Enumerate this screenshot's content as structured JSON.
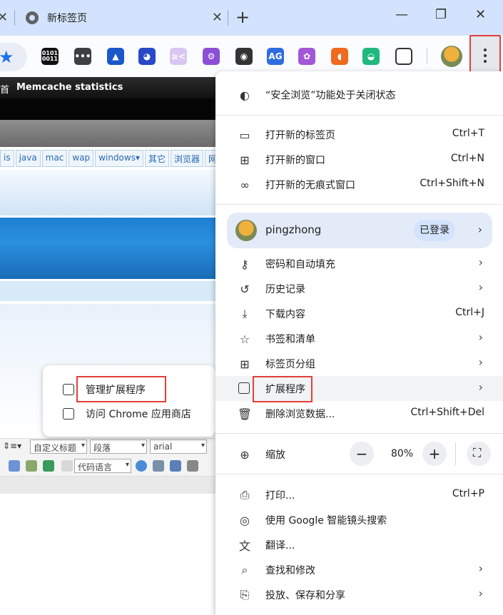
{
  "tab": {
    "title": "新标签页"
  },
  "toolbar": {
    "extensions": [
      {
        "name": "binary-extension",
        "text": "0101\n0011",
        "color": "#111111"
      },
      {
        "name": "dots-extension",
        "text": "•••",
        "color": "#3c4043"
      },
      {
        "name": "triangle-extension",
        "text": "▲",
        "color": "#1a58c9"
      },
      {
        "name": "robot-extension",
        "text": "◕",
        "color": "#2748c7"
      },
      {
        "name": "face-extension",
        "text": "≥<",
        "color": "#d9c6f2"
      },
      {
        "name": "gear-extension",
        "text": "⚙",
        "color": "#8b4fd6"
      },
      {
        "name": "camera-extension",
        "text": "◉",
        "color": "#333333"
      },
      {
        "name": "ag-extension",
        "text": "AG",
        "color": "#2f6ddf"
      },
      {
        "name": "brain-extension",
        "text": "✿",
        "color": "#a356d8"
      },
      {
        "name": "orange-extension",
        "text": "◖",
        "color": "#f06a1f"
      },
      {
        "name": "planet-extension",
        "text": "◒",
        "color": "#20b87f"
      }
    ]
  },
  "page": {
    "topbar_left": "首",
    "topbar_label": "Memcache statistics",
    "nav": [
      "is",
      "java",
      "mac",
      "wap",
      "windows▾",
      "其它",
      "浏览器",
      "网"
    ],
    "editor": {
      "heading_select": "自定义标题",
      "para_select": "段落",
      "font_select": "arial",
      "code_select": "代码语言"
    }
  },
  "submenu": {
    "items": [
      {
        "label": "管理扩展程序"
      },
      {
        "label": "访问 Chrome 应用商店"
      }
    ]
  },
  "menu": {
    "safe_browsing": "“安全浏览”功能处于关闭状态",
    "new_tab": {
      "label": "打开新的标签页",
      "shortcut": "Ctrl+T"
    },
    "new_window": {
      "label": "打开新的窗口",
      "shortcut": "Ctrl+N"
    },
    "incognito": {
      "label": "打开新的无痕式窗口",
      "shortcut": "Ctrl+Shift+N"
    },
    "profile": {
      "name": "pingzhong",
      "status": "已登录"
    },
    "passwords": {
      "label": "密码和自动填充"
    },
    "history": {
      "label": "历史记录"
    },
    "downloads": {
      "label": "下载内容",
      "shortcut": "Ctrl+J"
    },
    "bookmarks": {
      "label": "书签和清单"
    },
    "tab_groups": {
      "label": "标签页分组"
    },
    "extensions": {
      "label": "扩展程序"
    },
    "clear_data": {
      "label": "删除浏览数据...",
      "shortcut": "Ctrl+Shift+Del"
    },
    "zoom": {
      "label": "缩放",
      "value": "80%",
      "minus": "−",
      "plus": "+"
    },
    "print": {
      "label": "打印...",
      "shortcut": "Ctrl+P"
    },
    "lens": {
      "label": "使用 Google 智能镜头搜索"
    },
    "translate": {
      "label": "翻译..."
    },
    "find": {
      "label": "查找和修改"
    },
    "cast": {
      "label": "投放、保存和分享"
    }
  }
}
